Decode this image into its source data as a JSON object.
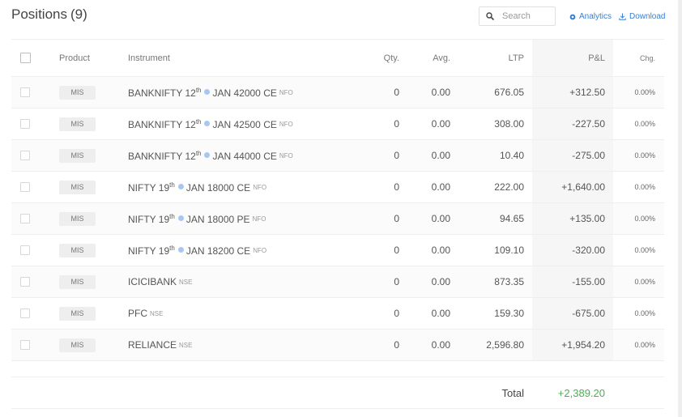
{
  "header": {
    "title": "Positions",
    "count": "(9)",
    "search_placeholder": "Search",
    "analytics_label": "Analytics",
    "download_label": "Download",
    "link_color": "#387ed1"
  },
  "columns": {
    "product": "Product",
    "instrument": "Instrument",
    "qty": "Qty.",
    "avg": "Avg.",
    "ltp": "LTP",
    "pnl": "P&L",
    "chg": "Chg."
  },
  "rows": [
    {
      "product": "MIS",
      "name": "BANKNIFTY 12",
      "sup": "th",
      "rest": "JAN 42000 CE",
      "weekly": true,
      "exchange": "NFO",
      "qty": "0",
      "avg": "0.00",
      "ltp": "676.05",
      "pnl": "+312.50",
      "chg": "0.00%"
    },
    {
      "product": "MIS",
      "name": "BANKNIFTY 12",
      "sup": "th",
      "rest": "JAN 42500 CE",
      "weekly": true,
      "exchange": "NFO",
      "qty": "0",
      "avg": "0.00",
      "ltp": "308.00",
      "pnl": "-227.50",
      "chg": "0.00%"
    },
    {
      "product": "MIS",
      "name": "BANKNIFTY 12",
      "sup": "th",
      "rest": "JAN 44000 CE",
      "weekly": true,
      "exchange": "NFO",
      "qty": "0",
      "avg": "0.00",
      "ltp": "10.40",
      "pnl": "-275.00",
      "chg": "0.00%"
    },
    {
      "product": "MIS",
      "name": "NIFTY 19",
      "sup": "th",
      "rest": "JAN 18000 CE",
      "weekly": true,
      "exchange": "NFO",
      "qty": "0",
      "avg": "0.00",
      "ltp": "222.00",
      "pnl": "+1,640.00",
      "chg": "0.00%"
    },
    {
      "product": "MIS",
      "name": "NIFTY 19",
      "sup": "th",
      "rest": "JAN 18000 PE",
      "weekly": true,
      "exchange": "NFO",
      "qty": "0",
      "avg": "0.00",
      "ltp": "94.65",
      "pnl": "+135.00",
      "chg": "0.00%"
    },
    {
      "product": "MIS",
      "name": "NIFTY 19",
      "sup": "th",
      "rest": "JAN 18200 CE",
      "weekly": true,
      "exchange": "NFO",
      "qty": "0",
      "avg": "0.00",
      "ltp": "109.10",
      "pnl": "-320.00",
      "chg": "0.00%"
    },
    {
      "product": "MIS",
      "name": "ICICIBANK",
      "sup": "",
      "rest": "",
      "weekly": false,
      "exchange": "NSE",
      "qty": "0",
      "avg": "0.00",
      "ltp": "873.35",
      "pnl": "-155.00",
      "chg": "0.00%"
    },
    {
      "product": "MIS",
      "name": "PFC",
      "sup": "",
      "rest": "",
      "weekly": false,
      "exchange": "NSE",
      "qty": "0",
      "avg": "0.00",
      "ltp": "159.30",
      "pnl": "-675.00",
      "chg": "0.00%"
    },
    {
      "product": "MIS",
      "name": "RELIANCE",
      "sup": "",
      "rest": "",
      "weekly": false,
      "exchange": "NSE",
      "qty": "0",
      "avg": "0.00",
      "ltp": "2,596.80",
      "pnl": "+1,954.20",
      "chg": "0.00%"
    }
  ],
  "footer": {
    "total_label": "Total",
    "total_value": "+2,389.20",
    "total_color": "#4caf50"
  }
}
